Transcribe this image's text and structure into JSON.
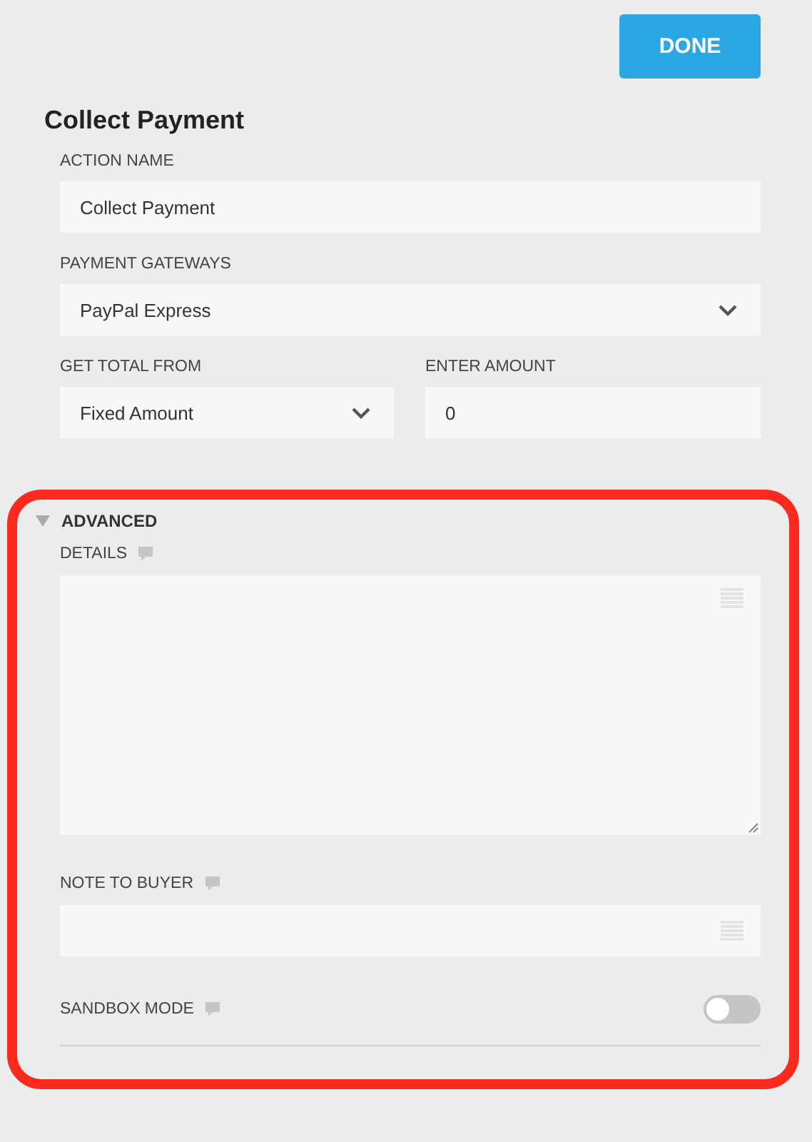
{
  "done_button": "DONE",
  "title": "Collect Payment",
  "fields": [
    {
      "label": "ACTION NAME",
      "kind": "text",
      "value": "Collect Payment"
    },
    {
      "label": "PAYMENT GATEWAYS",
      "kind": "select",
      "value": "PayPal Express"
    }
  ],
  "total_row": [
    {
      "label": "GET TOTAL FROM",
      "kind": "select",
      "value": "Fixed Amount"
    },
    {
      "label": "ENTER AMOUNT",
      "kind": "text",
      "value": "0"
    }
  ],
  "advanced": {
    "title": "ADVANCED",
    "expanded": true,
    "details": {
      "label": "DETAILS"
    },
    "note_to_buyer": {
      "label": "NOTE TO BUYER"
    },
    "sandbox_mode": {
      "label": "SANDBOX MODE",
      "on": false
    }
  }
}
